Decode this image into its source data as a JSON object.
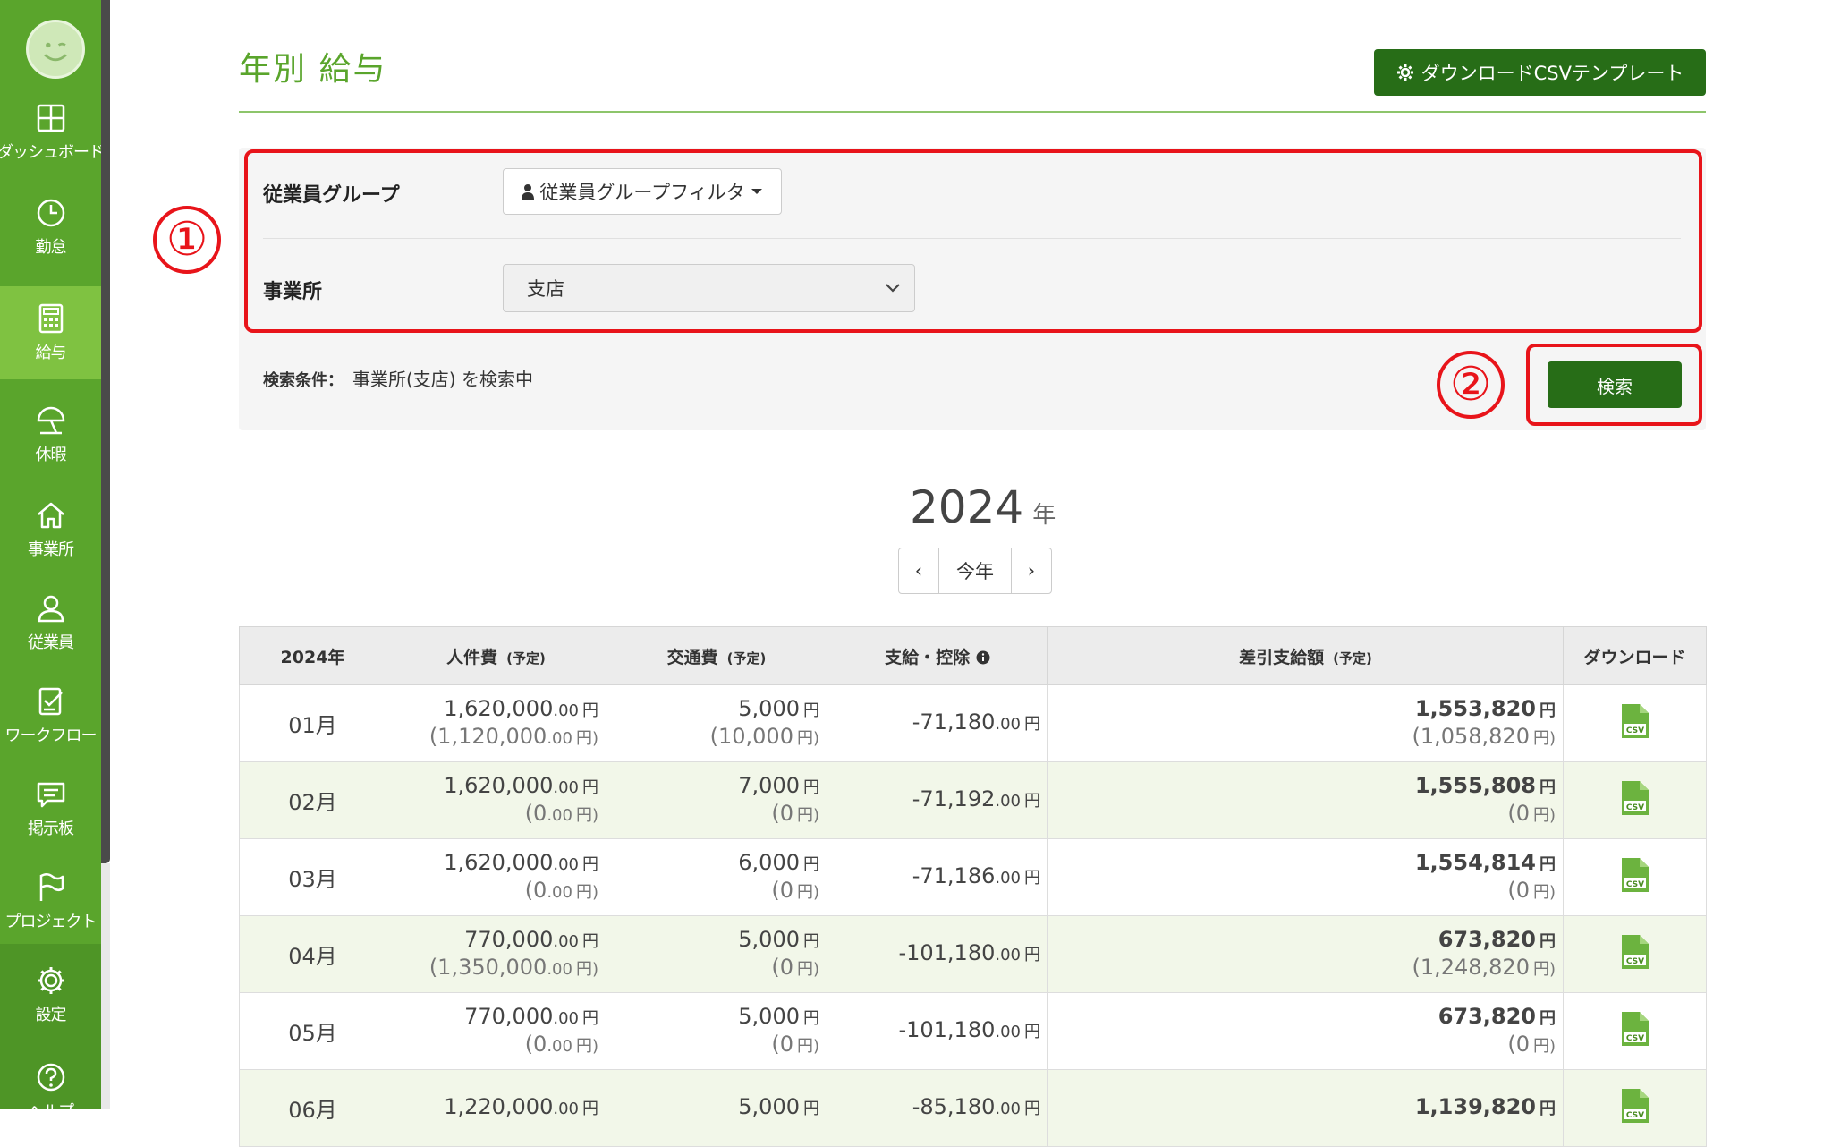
{
  "sidebar": {
    "items": [
      {
        "label": "ダッシュボード",
        "icon": "dashboard-icon"
      },
      {
        "label": "勤怠",
        "icon": "clock-icon"
      },
      {
        "label": "給与",
        "icon": "calculator-icon"
      },
      {
        "label": "休暇",
        "icon": "umbrella-icon"
      },
      {
        "label": "事業所",
        "icon": "home-icon"
      },
      {
        "label": "従業員",
        "icon": "person-icon"
      },
      {
        "label": "ワークフロー",
        "icon": "checklist-icon"
      },
      {
        "label": "掲示板",
        "icon": "chat-icon"
      },
      {
        "label": "プロジェクト",
        "icon": "flag-icon"
      },
      {
        "label": "設定",
        "icon": "gear-icon"
      },
      {
        "label": "ヘルプ",
        "icon": "help-icon"
      }
    ]
  },
  "header": {
    "title": "年別 給与",
    "csv_template_label": "ダウンロードCSVテンプレート"
  },
  "filters": {
    "group_label": "従業員グループ",
    "group_filter_label": "従業員グループフィルタ",
    "office_label": "事業所",
    "office_value": "支店",
    "search_condition_label": "検索条件：",
    "search_condition_text": "事業所(支店) を検索中",
    "search_button_label": "検索"
  },
  "annotations": {
    "one": "①",
    "two": "②"
  },
  "year": {
    "value": "2024",
    "unit": "年",
    "prev": "‹",
    "current": "今年",
    "next": "›"
  },
  "table": {
    "headers": {
      "year": "2024年",
      "labor": "人件費",
      "transport": "交通費",
      "payment": "支給・控除",
      "net": "差引支給額",
      "planned": "(予定)",
      "download": "ダウンロード"
    },
    "rows": [
      {
        "month": "01月",
        "labor": "1,620,000",
        "labor_dec": ".00",
        "labor_plan": "(1,120,000",
        "labor_plan_dec": ".00",
        "transport": "5,000",
        "transport_plan": "(10,000",
        "payment": "-71,180",
        "payment_dec": ".00",
        "net": "1,553,820",
        "net_plan": "(1,058,820"
      },
      {
        "month": "02月",
        "labor": "1,620,000",
        "labor_dec": ".00",
        "labor_plan": "(0",
        "labor_plan_dec": ".00",
        "transport": "7,000",
        "transport_plan": "(0",
        "payment": "-71,192",
        "payment_dec": ".00",
        "net": "1,555,808",
        "net_plan": "(0"
      },
      {
        "month": "03月",
        "labor": "1,620,000",
        "labor_dec": ".00",
        "labor_plan": "(0",
        "labor_plan_dec": ".00",
        "transport": "6,000",
        "transport_plan": "(0",
        "payment": "-71,186",
        "payment_dec": ".00",
        "net": "1,554,814",
        "net_plan": "(0"
      },
      {
        "month": "04月",
        "labor": "770,000",
        "labor_dec": ".00",
        "labor_plan": "(1,350,000",
        "labor_plan_dec": ".00",
        "transport": "5,000",
        "transport_plan": "(0",
        "payment": "-101,180",
        "payment_dec": ".00",
        "net": "673,820",
        "net_plan": "(1,248,820"
      },
      {
        "month": "05月",
        "labor": "770,000",
        "labor_dec": ".00",
        "labor_plan": "(0",
        "labor_plan_dec": ".00",
        "transport": "5,000",
        "transport_plan": "(0",
        "payment": "-101,180",
        "payment_dec": ".00",
        "net": "673,820",
        "net_plan": "(0"
      },
      {
        "month": "06月",
        "labor": "1,220,000",
        "labor_dec": ".00",
        "labor_plan": "",
        "labor_plan_dec": "",
        "transport": "5,000",
        "transport_plan": "",
        "payment": "-85,180",
        "payment_dec": ".00",
        "net": "1,139,820",
        "net_plan": ""
      }
    ],
    "yen": "円",
    "yen_close": "円)"
  },
  "colors": {
    "brand_green": "#5aa52c",
    "dark_green": "#276d17",
    "highlight_red": "#e8141a",
    "link_blue": "#1f6bb5"
  }
}
